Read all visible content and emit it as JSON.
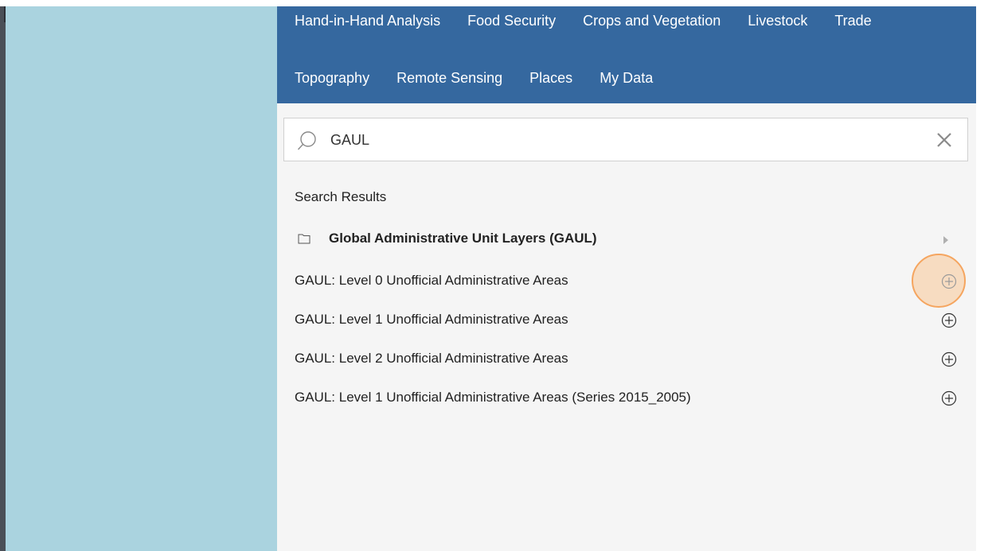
{
  "categories": {
    "row1": [
      "Hand-in-Hand Analysis",
      "Food Security",
      "Crops and Vegetation",
      "Livestock",
      "Trade"
    ],
    "row2": [
      "Topography",
      "Remote Sensing",
      "Places",
      "My Data"
    ]
  },
  "search": {
    "value": "GAUL",
    "icon": "search-icon",
    "clear_icon": "close-icon"
  },
  "results": {
    "title": "Search Results",
    "folder": {
      "label": "Global Administrative Unit Layers (GAUL)",
      "icon": "folder-icon"
    },
    "items": [
      {
        "label": "GAUL: Level 0 Unofficial Administrative Areas"
      },
      {
        "label": "GAUL: Level 1 Unofficial Administrative Areas"
      },
      {
        "label": "GAUL: Level 2 Unofficial Administrative Areas"
      },
      {
        "label": "GAUL: Level 1 Unofficial Administrative Areas (Series 2015_2005)"
      }
    ]
  },
  "colors": {
    "header": "#35689f",
    "map_water": "#aad3df",
    "panel_bg": "#f5f5f5",
    "highlight": "#f5a55f"
  }
}
